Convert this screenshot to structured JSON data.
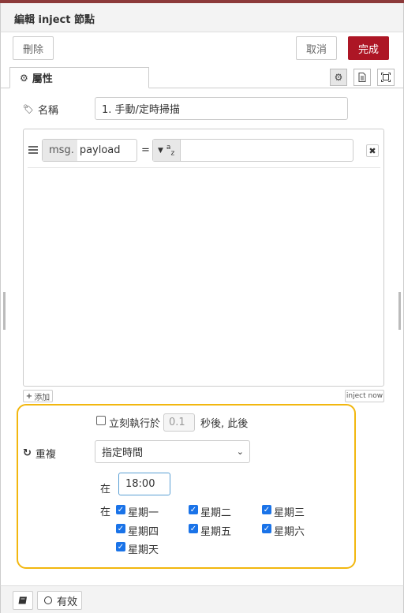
{
  "header": {
    "title": "編輯 inject 節點"
  },
  "toolbar": {
    "delete_label": "刪除",
    "cancel_label": "取消",
    "done_label": "完成"
  },
  "tabs": {
    "properties_label": "屬性"
  },
  "form": {
    "name_label": "名稱",
    "name_value": "1. 手動/定時掃描",
    "msg_prefix": "msg.",
    "msg_property": "payload",
    "equals": "=",
    "type_marker": "a",
    "type_marker_sub": "z",
    "add_label": "添加",
    "inject_now_label": "inject now",
    "run_once_label": "立刻執行於",
    "delay_value": "0.1",
    "delay_suffix": "秒後, 此後",
    "repeat_label": "重複",
    "repeat_mode": "指定時間",
    "at_label": "在",
    "time_value": "18:00",
    "on_label": "在",
    "days": [
      {
        "label": "星期一",
        "checked": true
      },
      {
        "label": "星期二",
        "checked": true
      },
      {
        "label": "星期三",
        "checked": true
      },
      {
        "label": "星期四",
        "checked": true
      },
      {
        "label": "星期五",
        "checked": true
      },
      {
        "label": "星期六",
        "checked": true
      },
      {
        "label": "星期天",
        "checked": true
      }
    ]
  },
  "footer": {
    "enabled_label": "有效"
  },
  "colors": {
    "primary": "#ad1625",
    "highlight": "#f2b70f",
    "checkbox": "#1a73e8"
  }
}
